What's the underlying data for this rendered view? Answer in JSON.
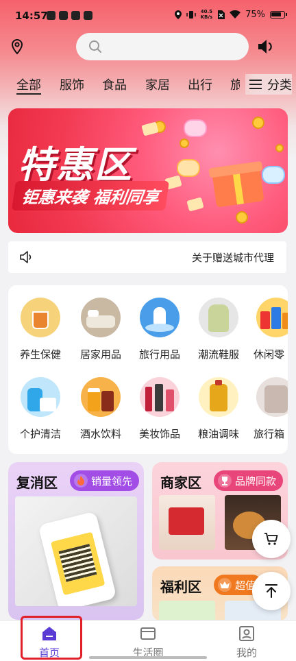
{
  "status_bar": {
    "time": "14:57",
    "net_speed_value": "40.5",
    "net_speed_unit": "KB/s",
    "battery": "75%"
  },
  "search": {
    "placeholder": ""
  },
  "tabs": [
    {
      "label": "全部",
      "active": true
    },
    {
      "label": "服饰"
    },
    {
      "label": "食品"
    },
    {
      "label": "家居"
    },
    {
      "label": "出行"
    },
    {
      "label": "旅"
    }
  ],
  "category_button": "分类",
  "banner": {
    "title": "特惠区",
    "slogan": "钜惠来袭 福利同享"
  },
  "notice": {
    "text": "关于赠送城市代理"
  },
  "categories": [
    {
      "label": "养生保健",
      "icon": "health-tea-icon"
    },
    {
      "label": "居家用品",
      "icon": "bedding-icon"
    },
    {
      "label": "旅行用品",
      "icon": "travel-icon"
    },
    {
      "label": "潮流鞋服",
      "icon": "jacket-icon"
    },
    {
      "label": "休闲零",
      "icon": "snacks-icon"
    },
    {
      "label": "个护清洁",
      "icon": "cleaning-icon"
    },
    {
      "label": "酒水饮料",
      "icon": "beer-icon"
    },
    {
      "label": "美妆饰品",
      "icon": "cosmetics-icon"
    },
    {
      "label": "粮油调味",
      "icon": "oil-icon"
    },
    {
      "label": "旅行箱",
      "icon": "suitcase-icon"
    }
  ],
  "promo": {
    "left": {
      "title": "复消区",
      "badge": "销量领先"
    },
    "right_top": {
      "title": "商家区",
      "badge": "品牌同款"
    },
    "right_bottom": {
      "title": "福利区",
      "badge": "超值"
    }
  },
  "bottom_nav": [
    {
      "label": "首页",
      "active": true
    },
    {
      "label": "生活圈"
    },
    {
      "label": "我的"
    }
  ],
  "colors": {
    "accent": "#5a3bd6",
    "banner_red": "#f23a52",
    "highlight": "#e0202a"
  }
}
